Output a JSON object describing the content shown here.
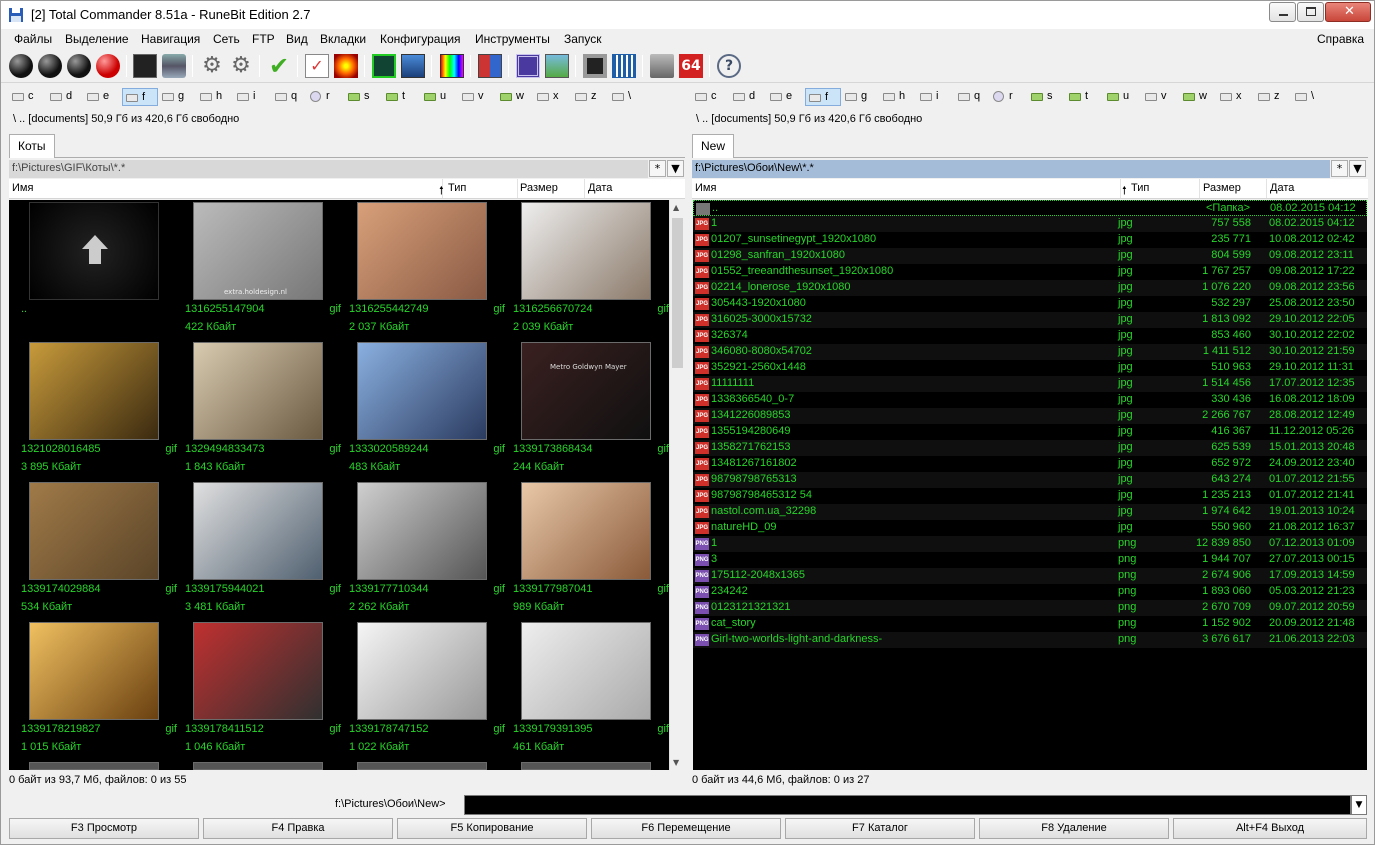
{
  "window": {
    "title": "[2] Total Commander 8.51a - RuneBit Edition 2.7"
  },
  "menu": {
    "items": [
      "Файлы",
      "Выделение",
      "Навигация",
      "Сеть",
      "FTP",
      "Вид",
      "Вкладки",
      "Конфигурация",
      "Инструменты",
      "Запуск"
    ],
    "help": "Справка"
  },
  "toolbar": {
    "buttons": [
      "record-black-1",
      "record-black-2",
      "record-black-3",
      "record-red",
      "ddu-icon",
      "stack-icon",
      "gear-icon",
      "gear-icon-2",
      "checkmark-icon",
      "checkbox-icon",
      "flame-icon",
      "film-icon",
      "monitor-icon",
      "palette-icon",
      "split-icon",
      "chip-icon",
      "picture-icon",
      "stop-icon",
      "equalizer-icon",
      "bin-icon",
      "64-icon",
      "help-icon"
    ],
    "badge_64": "64",
    "help": "?"
  },
  "drives": {
    "left": [
      "c",
      "d",
      "e",
      "f",
      "g",
      "h",
      "i",
      "q",
      "r",
      "s",
      "t",
      "u",
      "v",
      "w",
      "x",
      "z",
      "\\"
    ],
    "right": [
      "c",
      "d",
      "e",
      "f",
      "g",
      "h",
      "i",
      "q",
      "r",
      "s",
      "t",
      "u",
      "v",
      "w",
      "x",
      "z",
      "\\"
    ],
    "selected": "f"
  },
  "left": {
    "free": "\\   ..   [documents]  50,9 Гб из 420,6 Гб свободно",
    "tab": "Коты",
    "path": "f:\\Pictures\\GIF\\Коты\\*.*",
    "star": "*",
    "cols": {
      "name": "Имя",
      "type": "Тип",
      "size": "Размер",
      "date": "Дата"
    },
    "thumbs": [
      {
        "name": "..",
        "ext": "",
        "size": ""
      },
      {
        "name": "1316255147904",
        "ext": "gif",
        "size": "422 Кбайт"
      },
      {
        "name": "1316255442749",
        "ext": "gif",
        "size": "2 037 Кбайт"
      },
      {
        "name": "1316256670724",
        "ext": "gif",
        "size": "2 039 Кбайт"
      },
      {
        "name": "1321028016485",
        "ext": "gif",
        "size": "3 895 Кбайт"
      },
      {
        "name": "1329494833473",
        "ext": "gif",
        "size": "1 843 Кбайт"
      },
      {
        "name": "1333020589244",
        "ext": "gif",
        "size": "483 Кбайт"
      },
      {
        "name": "1339173868434",
        "ext": "gif",
        "size": "244 Кбайт"
      },
      {
        "name": "1339174029884",
        "ext": "gif",
        "size": "534 Кбайт"
      },
      {
        "name": "1339175944021",
        "ext": "gif",
        "size": "3 481 Кбайт"
      },
      {
        "name": "1339177710344",
        "ext": "gif",
        "size": "2 262 Кбайт"
      },
      {
        "name": "1339177987041",
        "ext": "gif",
        "size": "989 Кбайт"
      },
      {
        "name": "1339178219827",
        "ext": "gif",
        "size": "1 015 Кбайт"
      },
      {
        "name": "1339178411512",
        "ext": "gif",
        "size": "1 046 Кбайт"
      },
      {
        "name": "1339178747152",
        "ext": "gif",
        "size": "1 022 Кбайт"
      },
      {
        "name": "1339179391395",
        "ext": "gif",
        "size": "461 Кбайт"
      }
    ],
    "watermark": "extra.holdesign.nl",
    "mgm_text": "Metro Goldwyn Mayer",
    "status": "0 байт из 93,7 Мб, файлов: 0 из 55"
  },
  "right": {
    "free": "\\   ..   [documents]  50,9 Гб из 420,6 Гб свободно",
    "tab": "New",
    "path": "f:\\Pictures\\Обои\\New\\*.*",
    "star": "*",
    "cols": {
      "name": "Имя",
      "type": "Тип",
      "size": "Размер",
      "date": "Дата"
    },
    "files": [
      {
        "icon": "up",
        "name": "..",
        "ext": "",
        "size": "<Папка>",
        "date": "08.02.2015 04:12"
      },
      {
        "icon": "jpg",
        "name": "1",
        "ext": "jpg",
        "size": "757 558",
        "date": "08.02.2015 04:12"
      },
      {
        "icon": "jpg",
        "name": "01207_sunsetinegypt_1920x1080",
        "ext": "jpg",
        "size": "235 771",
        "date": "10.08.2012 02:42"
      },
      {
        "icon": "jpg",
        "name": "01298_sanfran_1920x1080",
        "ext": "jpg",
        "size": "804 599",
        "date": "09.08.2012 23:11"
      },
      {
        "icon": "jpg",
        "name": "01552_treeandthesunset_1920x1080",
        "ext": "jpg",
        "size": "1 767 257",
        "date": "09.08.2012 17:22"
      },
      {
        "icon": "jpg",
        "name": "02214_lonerose_1920x1080",
        "ext": "jpg",
        "size": "1 076 220",
        "date": "09.08.2012 23:56"
      },
      {
        "icon": "jpg",
        "name": "305443-1920x1080",
        "ext": "jpg",
        "size": "532 297",
        "date": "25.08.2012 23:50"
      },
      {
        "icon": "jpg",
        "name": "316025-3000x15732",
        "ext": "jpg",
        "size": "1 813 092",
        "date": "29.10.2012 22:05"
      },
      {
        "icon": "jpg",
        "name": "326374",
        "ext": "jpg",
        "size": "853 460",
        "date": "30.10.2012 22:02"
      },
      {
        "icon": "jpg",
        "name": "346080-8080x54702",
        "ext": "jpg",
        "size": "1 411 512",
        "date": "30.10.2012 21:59"
      },
      {
        "icon": "jpg",
        "name": "352921-2560x1448",
        "ext": "jpg",
        "size": "510 963",
        "date": "29.10.2012 11:31"
      },
      {
        "icon": "jpg",
        "name": "11111111",
        "ext": "jpg",
        "size": "1 514 456",
        "date": "17.07.2012 12:35"
      },
      {
        "icon": "jpg",
        "name": "1338366540_0-7",
        "ext": "jpg",
        "size": "330 436",
        "date": "16.08.2012 18:09"
      },
      {
        "icon": "jpg",
        "name": "1341226089853",
        "ext": "jpg",
        "size": "2 266 767",
        "date": "28.08.2012 12:49"
      },
      {
        "icon": "jpg",
        "name": "1355194280649",
        "ext": "jpg",
        "size": "416 367",
        "date": "11.12.2012 05:26"
      },
      {
        "icon": "jpg",
        "name": "1358271762153",
        "ext": "jpg",
        "size": "625 539",
        "date": "15.01.2013 20:48"
      },
      {
        "icon": "jpg",
        "name": "13481267161802",
        "ext": "jpg",
        "size": "652 972",
        "date": "24.09.2012 23:40"
      },
      {
        "icon": "jpg",
        "name": "98798798765313",
        "ext": "jpg",
        "size": "643 274",
        "date": "01.07.2012 21:55"
      },
      {
        "icon": "jpg",
        "name": "98798798465312 54",
        "ext": "jpg",
        "size": "1 235 213",
        "date": "01.07.2012 21:41"
      },
      {
        "icon": "jpg",
        "name": "nastol.com.ua_32298",
        "ext": "jpg",
        "size": "1 974 642",
        "date": "19.01.2013 10:24"
      },
      {
        "icon": "jpg",
        "name": "natureHD_09",
        "ext": "jpg",
        "size": "550 960",
        "date": "21.08.2012 16:37"
      },
      {
        "icon": "png",
        "name": "1",
        "ext": "png",
        "size": "12 839 850",
        "date": "07.12.2013 01:09"
      },
      {
        "icon": "png",
        "name": "3",
        "ext": "png",
        "size": "1 944 707",
        "date": "27.07.2013 00:15"
      },
      {
        "icon": "png",
        "name": "175112-2048x1365",
        "ext": "png",
        "size": "2 674 906",
        "date": "17.09.2013 14:59"
      },
      {
        "icon": "png",
        "name": "234242",
        "ext": "png",
        "size": "1 893 060",
        "date": "05.03.2012 21:23"
      },
      {
        "icon": "png",
        "name": "0123121321321",
        "ext": "png",
        "size": "2 670 709",
        "date": "09.07.2012 20:59"
      },
      {
        "icon": "png",
        "name": "cat_story",
        "ext": "png",
        "size": "1 152 902",
        "date": "20.09.2012 21:48"
      },
      {
        "icon": "png",
        "name": "Girl-two-worlds-light-and-darkness-",
        "ext": "png",
        "size": "3 676 617",
        "date": "21.06.2013 22:03"
      }
    ],
    "status": "0 байт из 44,6 Мб, файлов: 0 из 27"
  },
  "cmd": {
    "label": "f:\\Pictures\\Обои\\New>",
    "value": ""
  },
  "fkeys": [
    "F3 Просмотр",
    "F4 Правка",
    "F5 Копирование",
    "F6 Перемещение",
    "F7 Каталог",
    "F8 Удаление",
    "Alt+F4 Выход"
  ],
  "colors": {
    "file_green": "#27d62a",
    "panel_bg": "#000000",
    "path_active": "#a4bcd8"
  }
}
